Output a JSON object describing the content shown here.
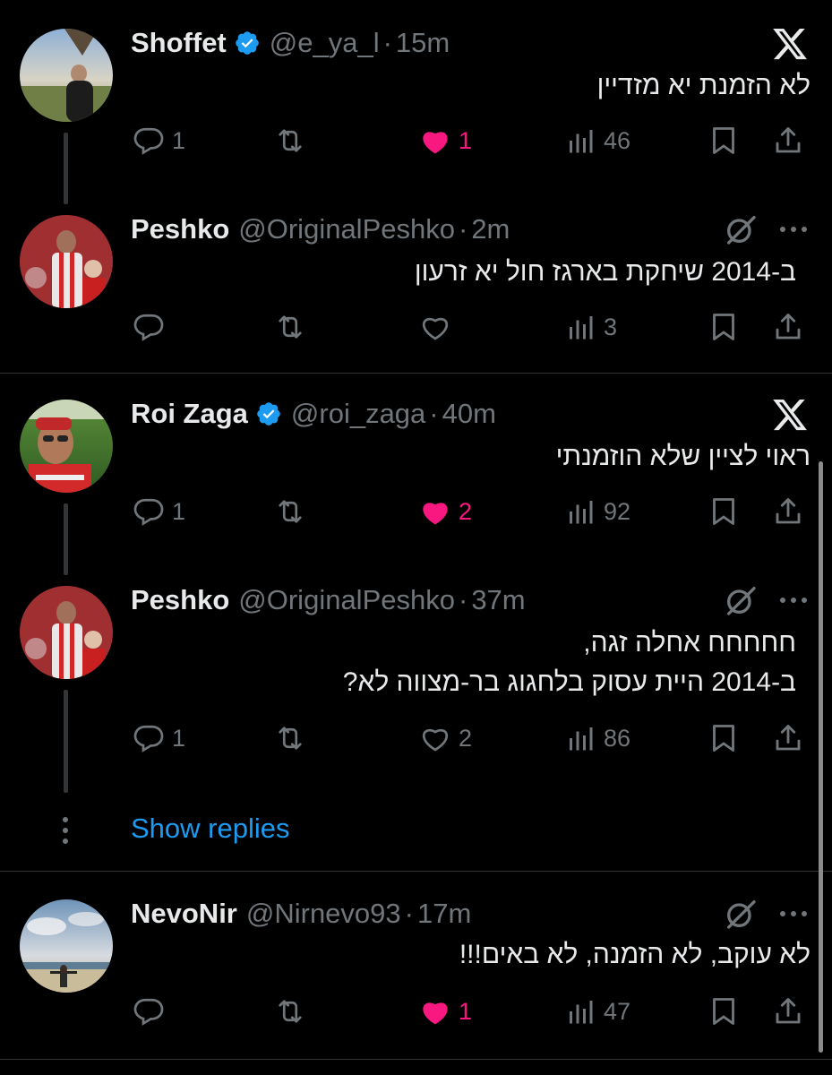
{
  "tweets": [
    {
      "name": "Shoffet",
      "handle": "@e_ya_l",
      "sep": "·",
      "time": "15m",
      "text": [
        "לא הזמנת יא מזדיין"
      ],
      "replies": "1",
      "likes": "1",
      "views": "46"
    },
    {
      "name": "Peshko",
      "handle": "@OriginalPeshko",
      "sep": "·",
      "time": "2m",
      "text": [
        "ב-2014 שיחקת בארגז חול יא זרעון"
      ],
      "replies": "",
      "likes": "",
      "views": "3"
    },
    {
      "name": "Roi Zaga",
      "handle": "@roi_zaga",
      "sep": "·",
      "time": "40m",
      "text": [
        "ראוי לציין שלא הוזמנתי"
      ],
      "replies": "1",
      "likes": "2",
      "views": "92"
    },
    {
      "name": "Peshko",
      "handle": "@OriginalPeshko",
      "sep": "·",
      "time": "37m",
      "text": [
        "חחחחח אחלה זגה,",
        "ב-2014 היית עסוק בלחגוג בר-מצווה לא?"
      ],
      "replies": "1",
      "likes": "2",
      "views": "86"
    },
    {
      "name": "NevoNir",
      "handle": "@Nirnevo93",
      "sep": "·",
      "time": "17m",
      "text": [
        "לא עוקב, לא הזמנה, לא באים!!!"
      ],
      "replies": "",
      "likes": "1",
      "views": "47"
    }
  ],
  "show_replies": "Show replies",
  "colors": {
    "background": "#000000",
    "text": "#e7e9ea",
    "muted": "#71767b",
    "like": "#f91880",
    "link": "#1d9bf0",
    "verified": "#1d9bf0"
  },
  "icons": [
    "x-logo-icon",
    "verified-icon",
    "grok-icon",
    "more-icon",
    "reply-icon",
    "retweet-icon",
    "like-icon",
    "views-icon",
    "bookmark-icon",
    "share-icon"
  ]
}
